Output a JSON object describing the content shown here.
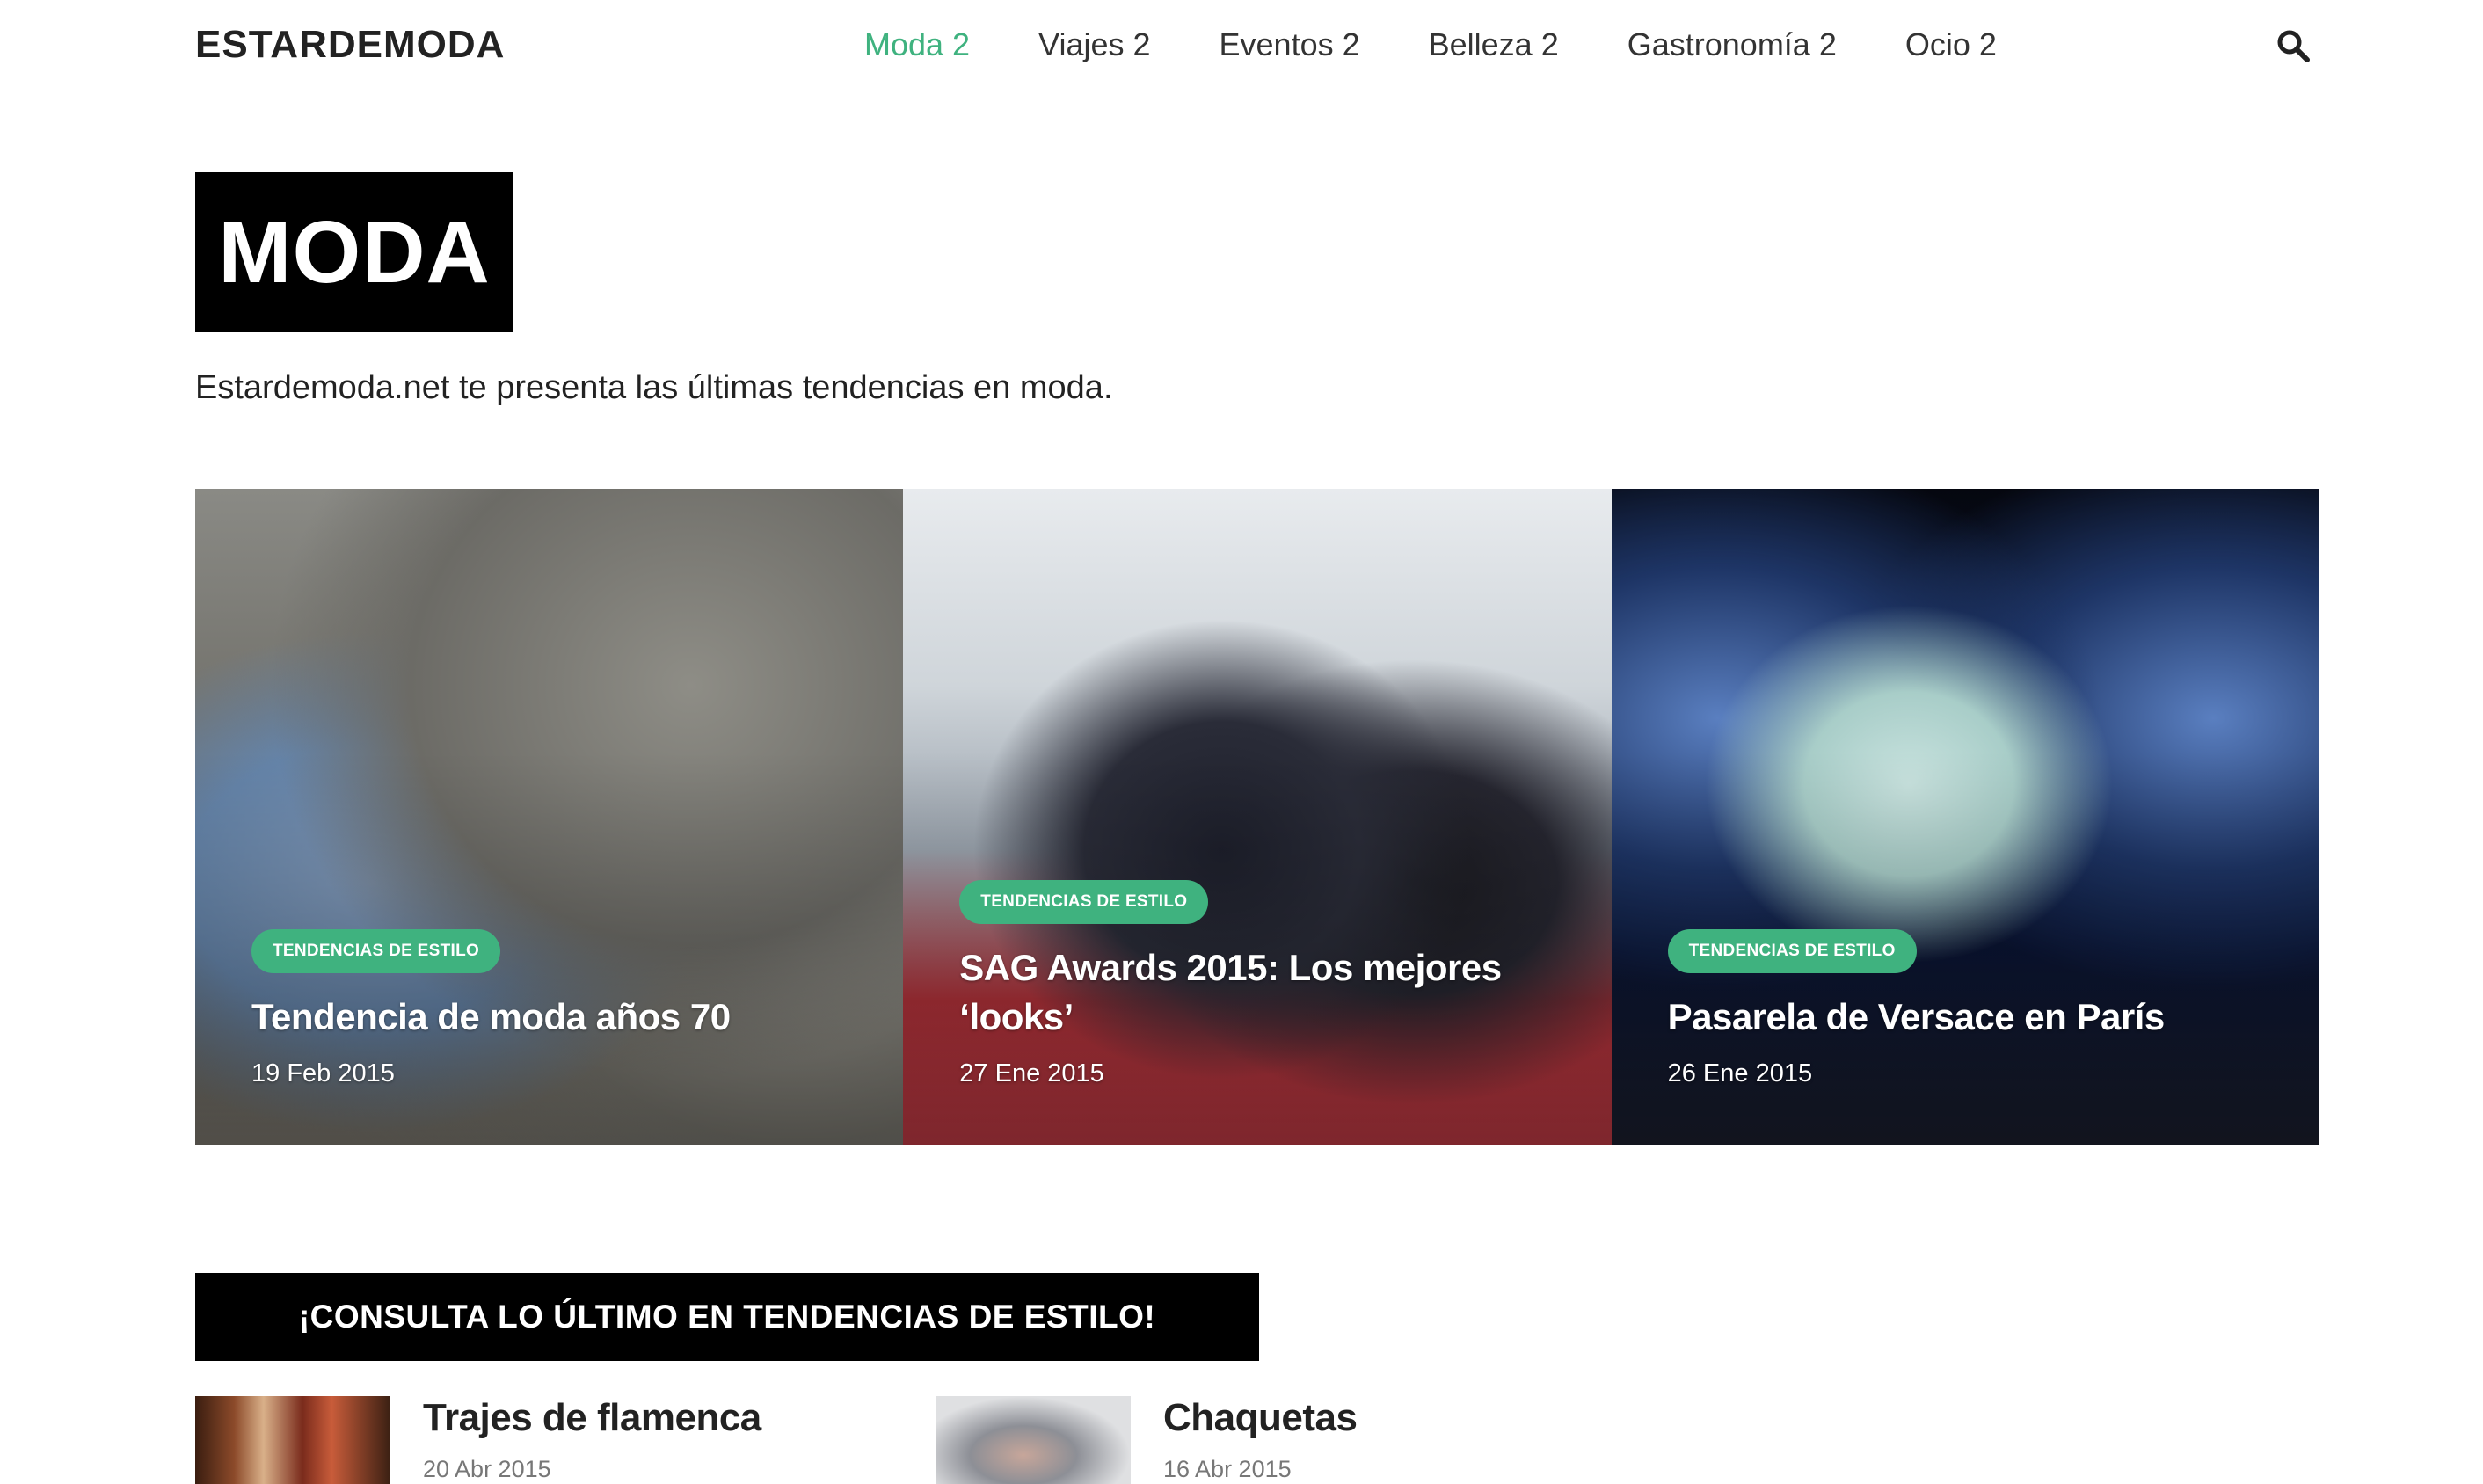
{
  "header": {
    "logo": "ESTARDEMODA",
    "nav": [
      {
        "label": "Moda 2",
        "active": true
      },
      {
        "label": "Viajes 2",
        "active": false
      },
      {
        "label": "Eventos 2",
        "active": false
      },
      {
        "label": "Belleza 2",
        "active": false
      },
      {
        "label": "Gastronomía 2",
        "active": false
      },
      {
        "label": "Ocio 2",
        "active": false
      }
    ],
    "search_icon": "search-icon"
  },
  "page": {
    "title": "MODA",
    "description": "Estardemoda.net te presenta las últimas tendencias en moda."
  },
  "featured": [
    {
      "category": "TENDENCIAS DE ESTILO",
      "title": "Tendencia de moda años 70",
      "date": "19 Feb 2015"
    },
    {
      "category": "TENDENCIAS DE ESTILO",
      "title": "SAG Awards 2015: Los mejores ‘looks’",
      "date": "27 Ene 2015"
    },
    {
      "category": "TENDENCIAS DE ESTILO",
      "title": "Pasarela de Versace en París",
      "date": "26 Ene 2015"
    }
  ],
  "section": {
    "heading": "¡CONSULTA LO ÚLTIMO EN TENDENCIAS DE ESTILO!",
    "items": [
      {
        "title": "Trajes de flamenca",
        "date": "20 Abr 2015"
      },
      {
        "title": "Chaquetas",
        "date": "16 Abr 2015"
      }
    ]
  },
  "colors": {
    "accent": "#3fb27f",
    "dark": "#000000",
    "text": "#222222"
  }
}
